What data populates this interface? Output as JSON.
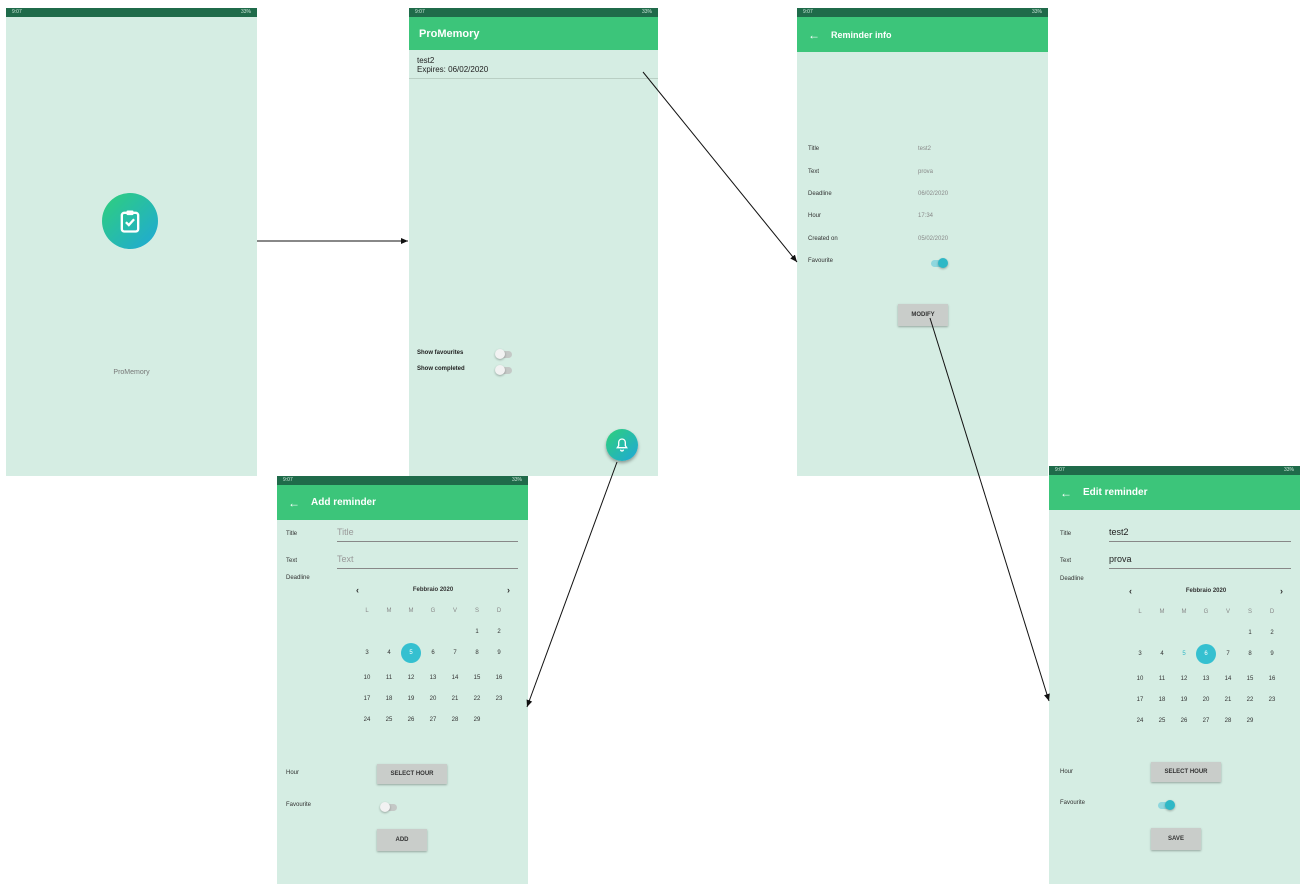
{
  "status": {
    "time": "9:07",
    "battery": "33%"
  },
  "splash": {
    "app_name": "ProMemory"
  },
  "main": {
    "title": "ProMemory",
    "item": {
      "title": "test2",
      "expires": "Expires: 06/02/2020"
    },
    "show_favourites": "Show favourites",
    "show_completed": "Show completed"
  },
  "info": {
    "title": "Reminder info",
    "rows": [
      {
        "label": "Title",
        "value": "test2"
      },
      {
        "label": "Text",
        "value": "prova"
      },
      {
        "label": "Deadline",
        "value": "06/02/2020"
      },
      {
        "label": "Hour",
        "value": "17:34"
      },
      {
        "label": "Created on",
        "value": "05/02/2020"
      }
    ],
    "favourite_label": "Favourite",
    "favourite_on": true,
    "modify_label": "MODIFY"
  },
  "add": {
    "title": "Add reminder",
    "title_label": "Title",
    "title_placeholder": "Title",
    "text_label": "Text",
    "text_placeholder": "Text",
    "deadline_label": "Deadline",
    "month": "Febbraio 2020",
    "dow": [
      "L",
      "M",
      "M",
      "G",
      "V",
      "S",
      "D"
    ],
    "selected_day": "5",
    "hour_label": "Hour",
    "select_hour": "SELECT HOUR",
    "favourite_label": "Favourite",
    "favourite_on": false,
    "add_label": "ADD"
  },
  "edit": {
    "title": "Edit reminder",
    "title_label": "Title",
    "title_value": "test2",
    "text_label": "Text",
    "text_value": "prova",
    "deadline_label": "Deadline",
    "month": "Febbraio 2020",
    "dow": [
      "L",
      "M",
      "M",
      "G",
      "V",
      "S",
      "D"
    ],
    "selected_day": "6",
    "hour_label": "Hour",
    "select_hour": "SELECT HOUR",
    "favourite_label": "Favourite",
    "favourite_on": true,
    "save_label": "SAVE"
  },
  "calendar_days": [
    [
      "",
      "",
      "",
      "",
      "",
      "1",
      "2"
    ],
    [
      "3",
      "4",
      "5",
      "6",
      "7",
      "8",
      "9"
    ],
    [
      "10",
      "11",
      "12",
      "13",
      "14",
      "15",
      "16"
    ],
    [
      "17",
      "18",
      "19",
      "20",
      "21",
      "22",
      "23"
    ],
    [
      "24",
      "25",
      "26",
      "27",
      "28",
      "29",
      ""
    ]
  ],
  "colors": {
    "appbar": "#3cc57a",
    "statusbar": "#1f6b4a",
    "background": "#d5ede3",
    "accent": "#2fb8c6"
  }
}
